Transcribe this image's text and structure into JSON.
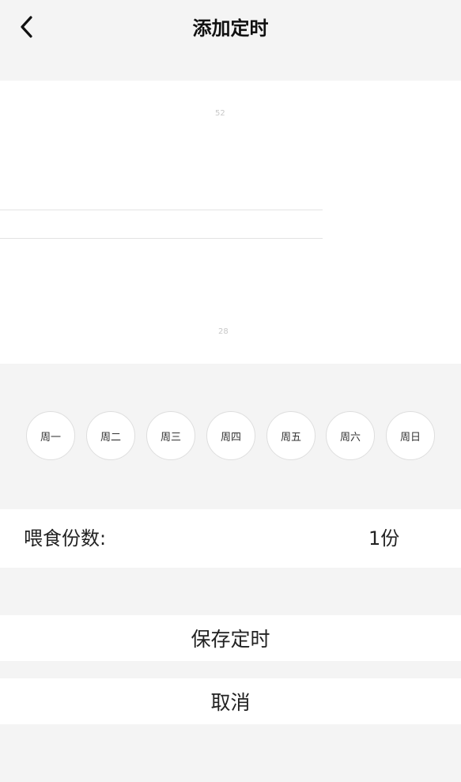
{
  "header": {
    "title": "添加定时",
    "back_icon": "chevron-left-icon"
  },
  "picker": {
    "faint_top": "52",
    "faint_bottom": "28"
  },
  "weekdays": [
    "周一",
    "周二",
    "周三",
    "周四",
    "周五",
    "周六",
    "周日"
  ],
  "feed": {
    "label": "喂食份数:",
    "value": "1份"
  },
  "actions": {
    "save_label": "保存定时",
    "cancel_label": "取消"
  },
  "colors": {
    "background": "#f4f4f4",
    "panel": "#ffffff",
    "day_border": "#dedede"
  }
}
